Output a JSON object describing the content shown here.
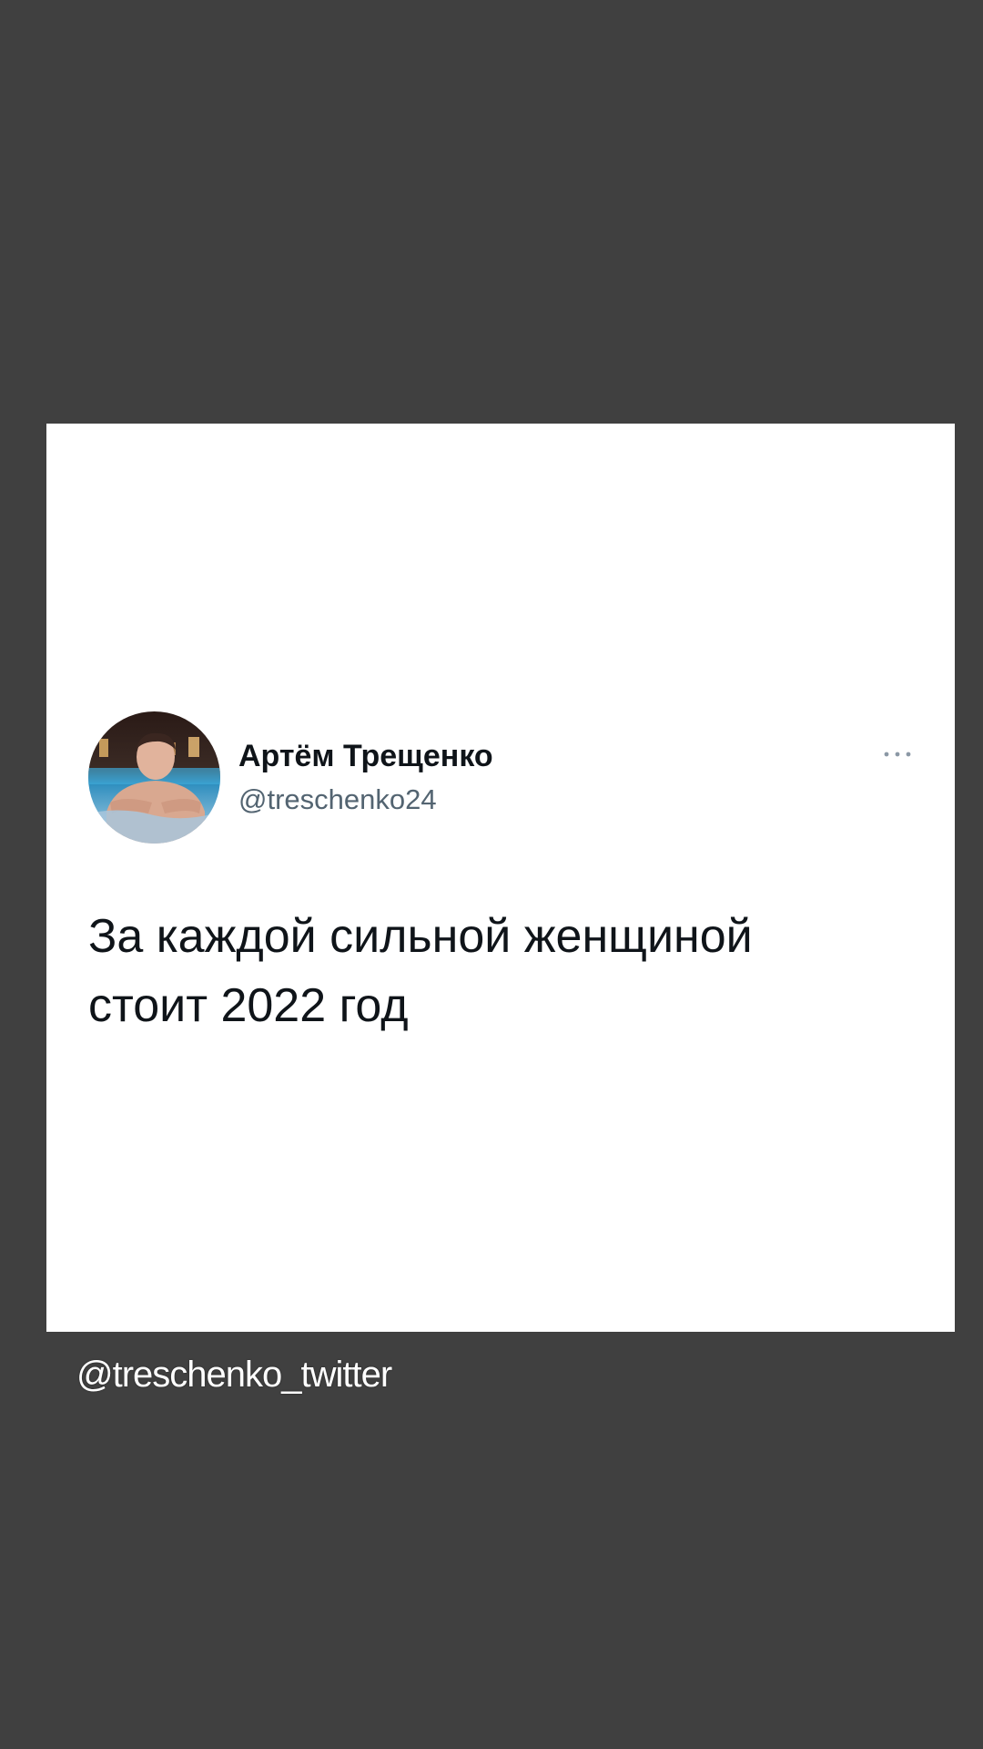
{
  "tweet": {
    "display_name": "Артём Трещенко",
    "handle": "@treschenko24",
    "text": "За каждой сильной женщиной\nстоит 2022 год",
    "more_icon": "more-horizontal-icon",
    "avatar_icon": "profile-photo"
  },
  "caption": {
    "text": "@treschenko_twitter"
  },
  "colors": {
    "background": "#404040",
    "card": "#ffffff",
    "text_primary": "#0f1419",
    "text_secondary": "#536471",
    "caption_text": "#ffffff"
  }
}
